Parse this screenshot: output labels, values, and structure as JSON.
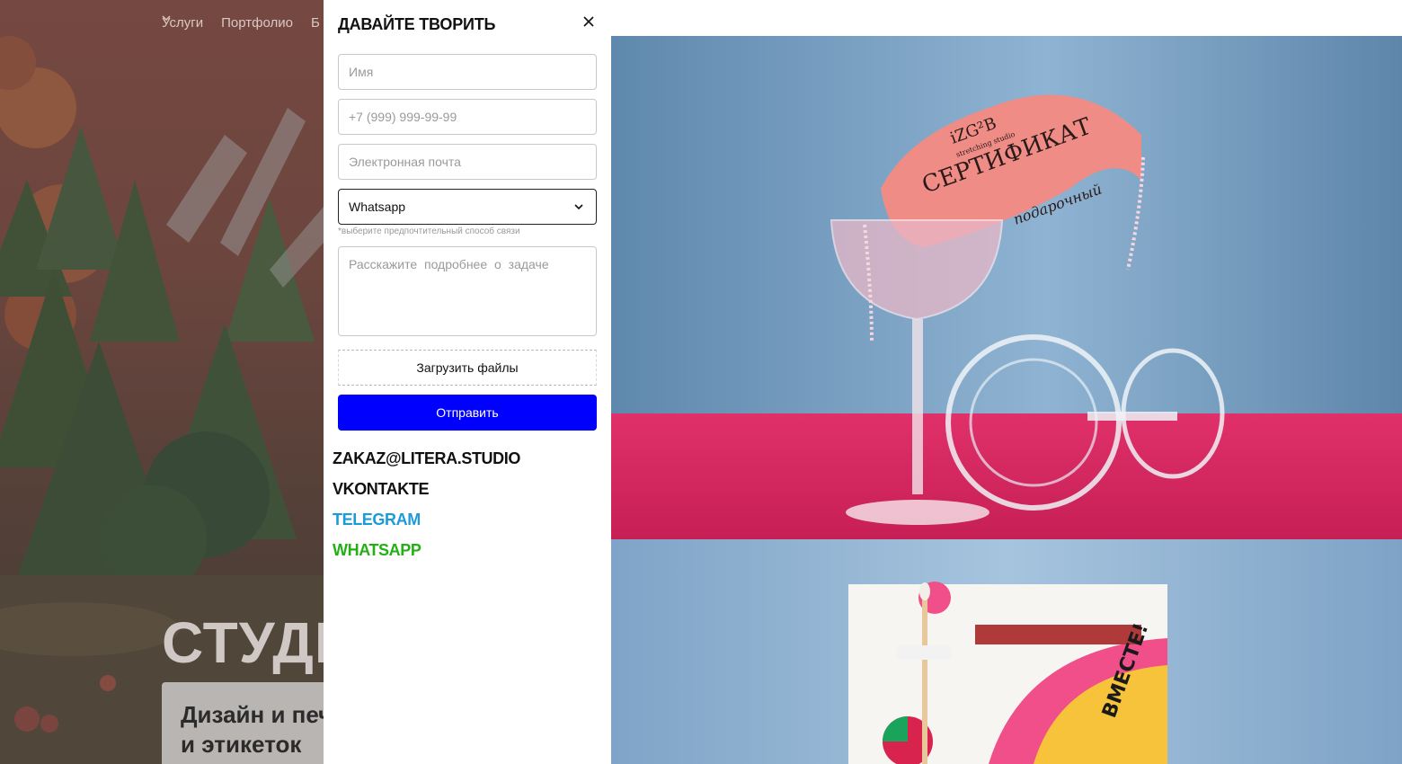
{
  "background": {
    "nav": [
      {
        "label": "Услуги"
      },
      {
        "label": "Портфолио"
      },
      {
        "label": "Б"
      }
    ],
    "hero_title": "СТУДИ",
    "hero_card_line1": "Дизайн и печ",
    "hero_card_line2": "и этикеток"
  },
  "modal": {
    "title": "ДАВАЙТЕ ТВОРИТЬ",
    "name_placeholder": "Имя",
    "phone_placeholder": "+7 (999) 999-99-99",
    "email_placeholder": "Электронная почта",
    "contact_method_selected": "Whatsapp",
    "contact_method_hint": "*выберите предпочтительный способ связи",
    "details_placeholder": "Расскажите подробнее о задаче",
    "upload_label": "Загрузить файлы",
    "submit_label": "Отправить",
    "contacts": [
      {
        "label": "ZAKAZ@LITERA.STUDIO",
        "color": "#111111"
      },
      {
        "label": "VKONTAKTE",
        "color": "#111111"
      },
      {
        "label": "TELEGRAM",
        "color": "#1c9bd8"
      },
      {
        "label": "WHATSAPP",
        "color": "#22b014"
      }
    ]
  },
  "gallery": {
    "certificate_brand": "iZG²B",
    "certificate_subbrand": "stretching studio",
    "certificate_word": "СЕРТИФИКАТ",
    "certificate_script": "подарочный",
    "card_text": "ВМЕСТЕ!"
  },
  "colors": {
    "submit": "#0000ff",
    "telegram": "#1c9bd8",
    "whatsapp": "#22b014",
    "photo_bg_blue": "#6a93b8",
    "photo_table_pink": "#d8295e"
  }
}
